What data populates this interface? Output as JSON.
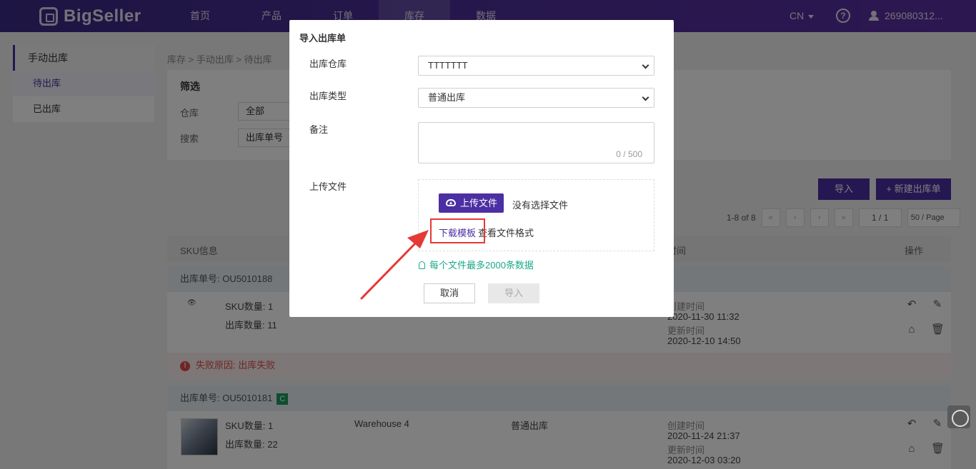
{
  "brand": {
    "name": "BigSeller",
    "accent": "#4b2fa3"
  },
  "nav": {
    "items": [
      "首页",
      "产品",
      "订单",
      "库存",
      "数据"
    ],
    "active_index": 3
  },
  "header": {
    "lang": "CN",
    "help_icon": "question-circle-icon",
    "user": "269080312..."
  },
  "sidebar": {
    "title": "手动出库",
    "items": [
      "待出库",
      "已出库"
    ],
    "active_index": 0
  },
  "breadcrumb": "库存 > 手动出库 > 待出库",
  "filter": {
    "title": "筛选",
    "warehouse_label": "仓库",
    "warehouse_value": "全部",
    "search_label": "搜索",
    "search_value": "出库单号"
  },
  "actions": {
    "import": "导入",
    "new": "+ 新建出库单"
  },
  "pager": {
    "summary": "1-8 of 8",
    "first": "«",
    "prev": "‹",
    "next": "›",
    "last": "»",
    "page": "1 / 1",
    "page_size": "50 / Page"
  },
  "table": {
    "headers": {
      "sku": "SKU信息",
      "time": "时间",
      "ops": "操作"
    },
    "orders": [
      {
        "number_label": "出库单号: OU5010188",
        "sku_count": "SKU数量: 1",
        "out_count": "出库数量: 11",
        "warehouse": "",
        "type": "",
        "created_label": "创建时间",
        "created": "2020-11-30 11:32",
        "updated_label": "更新时间",
        "updated": "2020-12-10 14:50",
        "fail_reason": "失败原因: 出库失败"
      },
      {
        "number_label": "出库单号: OU5010181",
        "badge": "C",
        "sku_count": "SKU数量: 1",
        "out_count": "出库数量: 22",
        "warehouse": "Warehouse 4",
        "type": "普通出库",
        "created_label": "创建时间",
        "created": "2020-11-24 21:37",
        "updated_label": "更新时间",
        "updated": "2020-12-03 03:20"
      }
    ]
  },
  "modal": {
    "title": "导入出库单",
    "warehouse_label": "出库仓库",
    "warehouse_value": "TTTTTTT",
    "type_label": "出库类型",
    "type_value": "普通出库",
    "remark_label": "备注",
    "remark_count": "0 / 500",
    "upload_label": "上传文件",
    "upload_button": "上传文件",
    "no_file": "没有选择文件",
    "download_template": "下载模板",
    "view_format": "查看文件格式",
    "tip": "每个文件最多2000条数据",
    "cancel": "取消",
    "submit": "导入"
  },
  "annotation": {
    "color": "#e53935"
  }
}
